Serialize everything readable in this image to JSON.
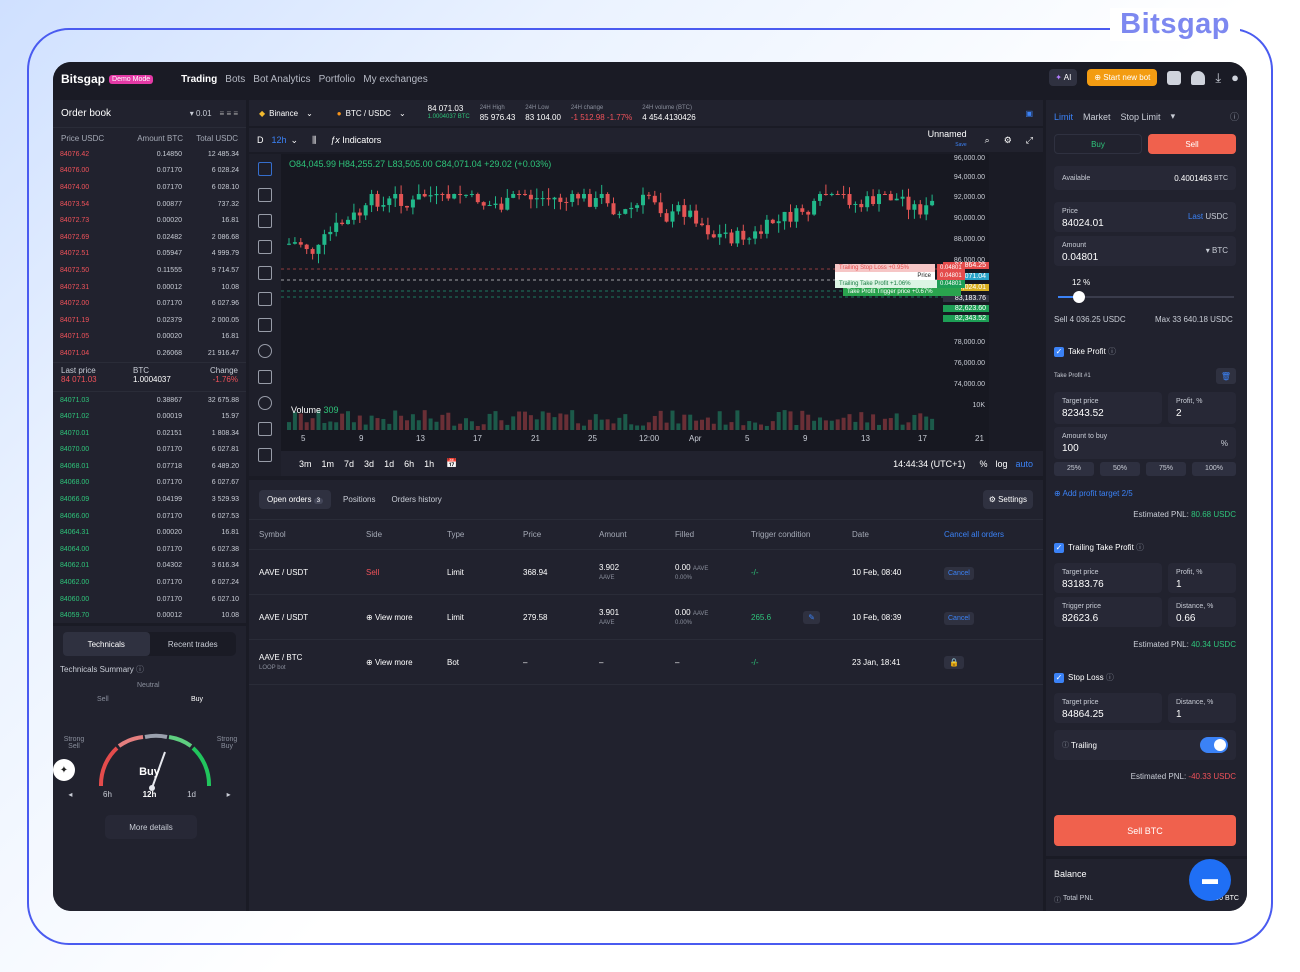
{
  "brand": "Bitsgap",
  "topbar": {
    "logo": "Bitsgap",
    "demo": "Demo Mode",
    "nav": [
      "Trading",
      "Bots",
      "Bot Analytics",
      "Portfolio",
      "My exchanges"
    ],
    "ai": "AI",
    "new_bot": "Start new bot"
  },
  "orderbook": {
    "title": "Order book",
    "step": "0.01",
    "cols": [
      "Price USDC",
      "Amount BTC",
      "Total USDC"
    ],
    "asks": [
      [
        "84076.42",
        "0.14850",
        "12 485.34"
      ],
      [
        "84076.00",
        "0.07170",
        "6 028.24"
      ],
      [
        "84074.00",
        "0.07170",
        "6 028.10"
      ],
      [
        "84073.54",
        "0.00877",
        "737.32"
      ],
      [
        "84072.73",
        "0.00020",
        "16.81"
      ],
      [
        "84072.69",
        "0.02482",
        "2 086.68"
      ],
      [
        "84072.51",
        "0.05947",
        "4 999.79"
      ],
      [
        "84072.50",
        "0.11555",
        "9 714.57"
      ],
      [
        "84072.31",
        "0.00012",
        "10.08"
      ],
      [
        "84072.00",
        "0.07170",
        "6 027.96"
      ],
      [
        "84071.19",
        "0.02379",
        "2 000.05"
      ],
      [
        "84071.05",
        "0.00020",
        "16.81"
      ],
      [
        "84071.04",
        "0.26068",
        "21 916.47"
      ]
    ],
    "last": {
      "label": "Last price",
      "value": "84 071.03",
      "btc_label": "BTC",
      "btc": "1.0004037",
      "change_label": "Change",
      "change": "-1.76%"
    },
    "bids": [
      [
        "84071.03",
        "0.38867",
        "32 675.88"
      ],
      [
        "84071.02",
        "0.00019",
        "15.97"
      ],
      [
        "84070.01",
        "0.02151",
        "1 808.34"
      ],
      [
        "84070.00",
        "0.07170",
        "6 027.81"
      ],
      [
        "84068.01",
        "0.07718",
        "6 489.20"
      ],
      [
        "84068.00",
        "0.07170",
        "6 027.67"
      ],
      [
        "84066.09",
        "0.04199",
        "3 529.93"
      ],
      [
        "84066.00",
        "0.07170",
        "6 027.53"
      ],
      [
        "84064.31",
        "0.00020",
        "16.81"
      ],
      [
        "84064.00",
        "0.07170",
        "6 027.38"
      ],
      [
        "84062.01",
        "0.04302",
        "3 616.34"
      ],
      [
        "84062.00",
        "0.07170",
        "6 027.24"
      ],
      [
        "84060.00",
        "0.07170",
        "6 027.10"
      ],
      [
        "84059.70",
        "0.00012",
        "10.08"
      ]
    ]
  },
  "technicals": {
    "tabs": [
      "Technicals",
      "Recent trades"
    ],
    "summary": "Technicals Summary",
    "labels": [
      "Neutral",
      "Sell",
      "Buy",
      "Strong Sell",
      "Strong Buy"
    ],
    "result": "Buy",
    "timeframes": [
      "6h",
      "12h",
      "1d"
    ],
    "more": "More details"
  },
  "market": {
    "exchange": "Binance",
    "pair": "BTC / USDC",
    "price": "84 071.03",
    "price_btc": "1.0004037 BTC",
    "h_label": "24H High",
    "h": "85 976.43",
    "l_label": "24H Low",
    "l": "83 104.00",
    "c_label": "24H change",
    "c": "-1 512.98 -1.77%",
    "v_label": "24H volume (BTC)",
    "v": "4 454.4130426"
  },
  "chart": {
    "interval": "12h",
    "d": "D",
    "indicators": "Indicators",
    "layout": "Unnamed",
    "save": "Save",
    "ohlc": "O84,045.99 H84,255.27 L83,505.00 C84,071.04 +29.02 (+0.03%)",
    "volume": "Volume",
    "volume_val": "309",
    "yticks": [
      "96,000.00",
      "94,000.00",
      "92,000.00",
      "90,000.00",
      "88,000.00",
      "86,000.00",
      "78,000.00",
      "76,000.00",
      "74,000.00",
      "10K"
    ],
    "xticks": [
      "5",
      "9",
      "13",
      "17",
      "21",
      "25",
      "12:00",
      "Apr",
      "5",
      "9",
      "13",
      "17",
      "21"
    ],
    "tags": [
      [
        "84,864.25",
        "#e44c4c"
      ],
      [
        "84,071.04",
        "#2aa3c9"
      ],
      [
        "84,024.01",
        "#d9b021"
      ],
      [
        "83,183.76",
        "#2f3140"
      ],
      [
        "82,623.60",
        "#1d9e55"
      ],
      [
        "82,343.52",
        "#1d9e55"
      ]
    ],
    "labels": [
      "Trailing Stop Loss +0.95%",
      "Price",
      "Trailing Take Profit +1.06%",
      "Take Profit Trigger price +0.67%"
    ],
    "label_vals": [
      "0.04801",
      "0.04801",
      "0.04801"
    ],
    "ranges": [
      "3m",
      "1m",
      "7d",
      "3d",
      "1d",
      "6h",
      "1h"
    ],
    "time": "14:44:34 (UTC+1)",
    "scale": [
      "%",
      "log",
      "auto"
    ]
  },
  "orders": {
    "tabs": [
      "Open orders",
      "Positions",
      "Orders history"
    ],
    "count": "3",
    "settings": "Settings",
    "cols": [
      "Symbol",
      "Side",
      "Type",
      "Price",
      "Amount",
      "Filled",
      "Trigger condition",
      "Date",
      "Cancel all orders"
    ],
    "rows": [
      {
        "sym": "AAVE / USDT",
        "side": "Sell",
        "type": "Limit",
        "price": "368.94",
        "amt": "3.902",
        "amt_u": "AAVE",
        "fill": "0.00",
        "fill_u": "AAVE",
        "fill_p": "0.00%",
        "trig": "-/-",
        "date": "10 Feb, 08:40",
        "act": "Cancel"
      },
      {
        "sym": "AAVE / USDT",
        "side": "View more",
        "type": "Limit",
        "price": "279.58",
        "amt": "3.901",
        "amt_u": "AAVE",
        "fill": "0.00",
        "fill_u": "AAVE",
        "fill_p": "0.00%",
        "trig": "265.6",
        "date": "10 Feb, 08:39",
        "act": "Cancel"
      },
      {
        "sym": "AAVE / BTC",
        "sub": "LOOP bot",
        "side": "View more",
        "type": "Bot",
        "price": "–",
        "amt": "–",
        "fill": "–",
        "trig": "-/-",
        "date": "23 Jan, 18:41"
      }
    ]
  },
  "trade": {
    "tabs": [
      "Limit",
      "Market",
      "Stop Limit"
    ],
    "buy": "Buy",
    "sell": "Sell",
    "available_label": "Available",
    "available": "0.4001463",
    "available_unit": "BTC",
    "price_label": "Price",
    "price": "84024.01",
    "last": "Last",
    "price_unit": "USDC",
    "amount_label": "Amount",
    "amount": "0.04801",
    "amount_unit": "BTC",
    "slider": "12 %",
    "slider_value": 0.12,
    "sell_total": "Sell 4 036.25 USDC",
    "max": "Max 33 640.18 USDC",
    "tp": {
      "label": "Take Profit",
      "sub": "Take Profit #1",
      "target_label": "Target price",
      "target": "82343.52",
      "profit_label": "Profit, %",
      "profit": "2",
      "amount_label": "Amount to buy",
      "amount": "100",
      "pct_sign": "%",
      "pcts": [
        "25%",
        "50%",
        "75%",
        "100%"
      ],
      "add": "Add profit target 2/5",
      "pnl_label": "Estimated PNL:",
      "pnl": "80.68 USDC"
    },
    "ttp": {
      "label": "Trailing Take Profit",
      "target_label": "Target price",
      "target": "83183.76",
      "profit_label": "Profit, %",
      "profit": "1",
      "trig_label": "Trigger price",
      "trig": "82623.6",
      "dist_label": "Distance, %",
      "dist": "0.66",
      "pnl_label": "Estimated PNL:",
      "pnl": "40.34 USDC"
    },
    "sl": {
      "label": "Stop Loss",
      "target_label": "Target price",
      "target": "84864.25",
      "dist_label": "Distance, %",
      "dist": "1",
      "trailing": "Trailing",
      "pnl_label": "Estimated PNL:",
      "pnl": "-40.33 USDC"
    },
    "sell_btn": "Sell BTC",
    "balance": "Balance",
    "total_pnl": "Total PNL",
    "total_pnl_val": "0.00 BTC"
  }
}
